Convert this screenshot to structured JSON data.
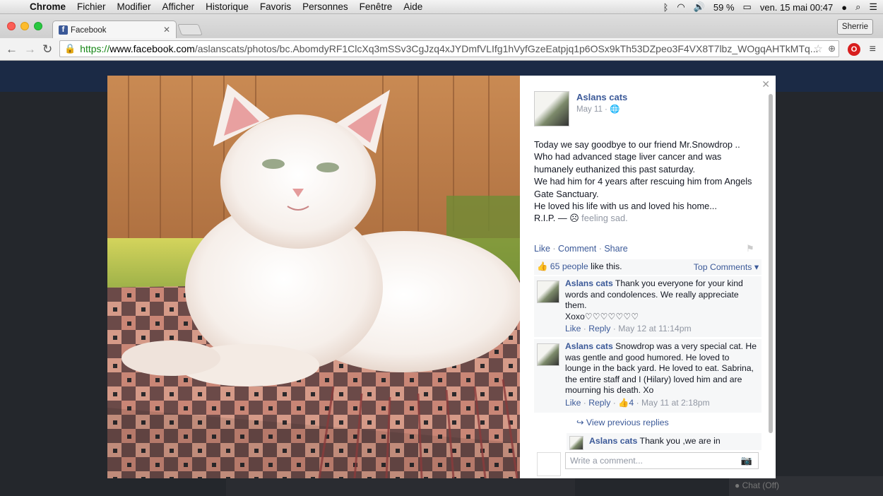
{
  "menubar": {
    "items": [
      "Chrome",
      "Fichier",
      "Modifier",
      "Afficher",
      "Historique",
      "Favoris",
      "Personnes",
      "Fenêtre",
      "Aide"
    ],
    "battery": "59 %",
    "datetime": "ven. 15 mai  00:47"
  },
  "browser": {
    "tab_title": "Facebook",
    "profile": "Sherrie",
    "url_scheme": "https://",
    "url_host": "www.facebook.com",
    "url_path": "/aslanscats/photos/bc.AbomdyRF1ClcXq3mSSv3CgJzq4xJYDmfVLIfg1hVyfGzeEatpjq1p6OSx9kTh53DZpeo3F4VX8T7lbz_WOgqAHTkMTq..."
  },
  "post": {
    "author": "Aslans cats",
    "date": "May 11 ·",
    "lines": [
      "Today we say goodbye to our friend Mr.Snowdrop ..",
      "Who had advanced stage liver cancer and was",
      "humanely euthanized this past saturday.",
      "We had him for 4 years after rescuing him from Angels",
      "Gate Sanctuary.",
      "He loved his life with us and loved his home..."
    ],
    "rip": "R.I.P. — ",
    "feeling": "feeling sad.",
    "actions": {
      "like": "Like",
      "comment": "Comment",
      "share": "Share"
    },
    "likes_count": "65 people",
    "likes_suffix": " like this.",
    "top_comments": "Top Comments ▾"
  },
  "comments": [
    {
      "author": "Aslans cats",
      "text": " Thank you everyone for your kind words and condolences. We really appreciate them.",
      "text2": "Xoxo♡♡♡♡♡♡♡",
      "like": "Like",
      "reply": "Reply",
      "likes": "",
      "time": "May 12 at 11:14pm"
    },
    {
      "author": "Aslans cats",
      "text": " Snowdrop was a very special cat. He was gentle and good humored. He loved to lounge in the back yard. He loved to eat. Sabrina, the entire staff and I (Hilary) loved him and are mourning his death. Xo",
      "text2": "",
      "like": "Like",
      "reply": "Reply",
      "likes": "4",
      "time": "May 11 at 2:18pm"
    }
  ],
  "view_previous": "View previous replies",
  "reply_preview": {
    "author": "Aslans cats",
    "text": " Thank you ,we are in"
  },
  "write_placeholder": "Write a comment...",
  "background": {
    "chat": "Chat (Off)"
  }
}
